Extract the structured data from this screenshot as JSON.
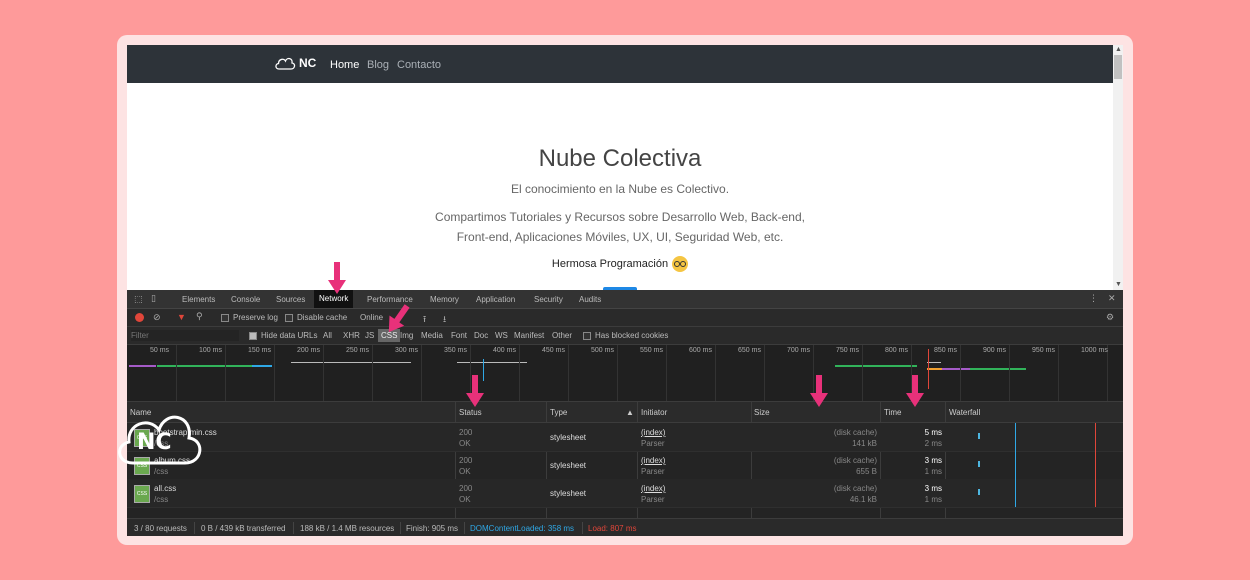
{
  "site": {
    "logo_text": "NC",
    "nav": [
      "Home",
      "Blog",
      "Contacto"
    ],
    "title": "Nube Colectiva",
    "subtitle": "El conocimiento en la Nube es Colectivo.",
    "paragraph_line1": "Compartimos Tutoriales y Recursos sobre Desarrollo Web, Back-end,",
    "paragraph_line2": "Front-end, Aplicaciones Móviles, UX, UI, Seguridad Web, etc.",
    "tagline": "Hermosa Programación"
  },
  "devtools": {
    "tabs": [
      "Elements",
      "Console",
      "Sources",
      "Network",
      "Performance",
      "Memory",
      "Application",
      "Security",
      "Audits"
    ],
    "active_tab": "Network",
    "toolbar": {
      "preserve_log": "Preserve log",
      "disable_cache": "Disable cache",
      "throttling": "Online"
    },
    "filter": {
      "placeholder": "Filter",
      "hide_data_urls": "Hide data URLs",
      "types": [
        "All",
        "XHR",
        "JS",
        "CSS",
        "Img",
        "Media",
        "Font",
        "Doc",
        "WS",
        "Manifest",
        "Other"
      ],
      "active_type": "CSS",
      "has_blocked_cookies": "Has blocked cookies"
    },
    "timeline_ticks": [
      "50 ms",
      "100 ms",
      "150 ms",
      "200 ms",
      "250 ms",
      "300 ms",
      "350 ms",
      "400 ms",
      "450 ms",
      "500 ms",
      "550 ms",
      "600 ms",
      "650 ms",
      "700 ms",
      "750 ms",
      "800 ms",
      "850 ms",
      "900 ms",
      "950 ms",
      "1000 ms"
    ],
    "columns": {
      "name": "Name",
      "status": "Status",
      "type": "Type",
      "initiator": "Initiator",
      "size": "Size",
      "time": "Time",
      "waterfall": "Waterfall"
    },
    "rows": [
      {
        "name": "bootstrap.min.css",
        "path": "/css",
        "status": "200",
        "status_text": "OK",
        "type": "stylesheet",
        "initiator": "(index)",
        "initiator_sub": "Parser",
        "size_from": "(disk cache)",
        "size": "141 kB",
        "time": "5 ms",
        "latency": "2 ms"
      },
      {
        "name": "album.css",
        "path": "/css",
        "status": "200",
        "status_text": "OK",
        "type": "stylesheet",
        "initiator": "(index)",
        "initiator_sub": "Parser",
        "size_from": "(disk cache)",
        "size": "655 B",
        "time": "3 ms",
        "latency": "1 ms"
      },
      {
        "name": "all.css",
        "path": "/css",
        "status": "200",
        "status_text": "OK",
        "type": "stylesheet",
        "initiator": "(index)",
        "initiator_sub": "Parser",
        "size_from": "(disk cache)",
        "size": "46.1 kB",
        "time": "3 ms",
        "latency": "1 ms"
      }
    ],
    "status_bar": {
      "requests": "3 / 80 requests",
      "transferred": "0 B / 439 kB transferred",
      "resources": "188 kB / 1.4 MB resources",
      "finish": "Finish: 905 ms",
      "dom_content_loaded": "DOMContentLoaded: 358 ms",
      "load": "Load: 807 ms"
    },
    "colors": {
      "dcl": "#2fa8e6",
      "load": "#e0463a"
    }
  },
  "watermark": {
    "text": "NC"
  },
  "annotation_color": "#e8317a"
}
